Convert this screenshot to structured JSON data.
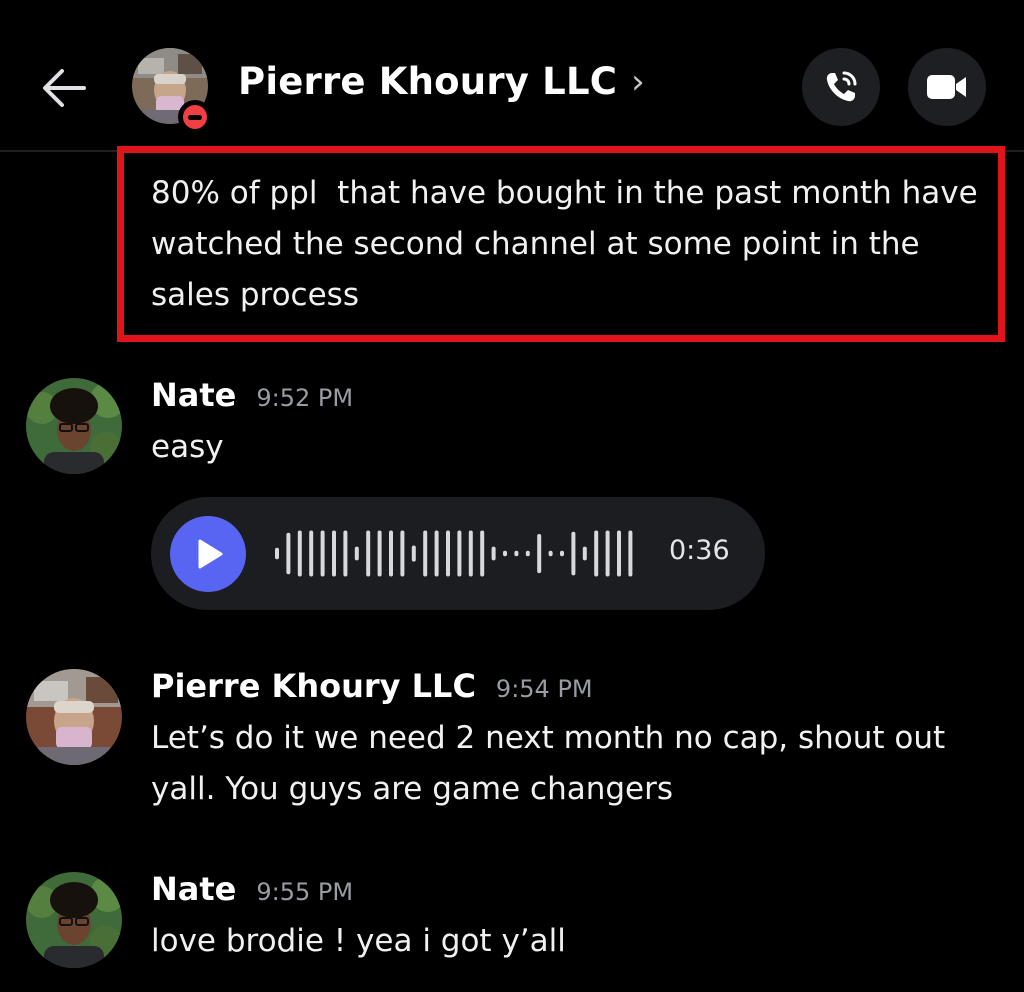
{
  "header": {
    "title": "Pierre Khoury LLC",
    "title_chevron": "›",
    "back_icon": "arrow-left-icon",
    "call_icon": "phone-call-icon",
    "video_icon": "video-camera-icon",
    "status": "do-not-disturb",
    "status_color": "#f23f43"
  },
  "highlight_color": "#e0151b",
  "top_message": {
    "text": "80% of ppl  that have bought in the past month have watched the second channel at some point in the sales process"
  },
  "messages": [
    {
      "author": "Nate",
      "time": "9:52 PM",
      "text": "easy",
      "voice": {
        "duration": "0:36",
        "accent": "#5865f2"
      }
    },
    {
      "author": "Pierre Khoury LLC",
      "time": "9:54 PM",
      "text": "Let’s do it we need 2 next month no cap, shout out yall. You guys are game changers"
    },
    {
      "author": "Nate",
      "time": "9:55 PM",
      "text": "love brodie ! yea i got y’all"
    }
  ]
}
